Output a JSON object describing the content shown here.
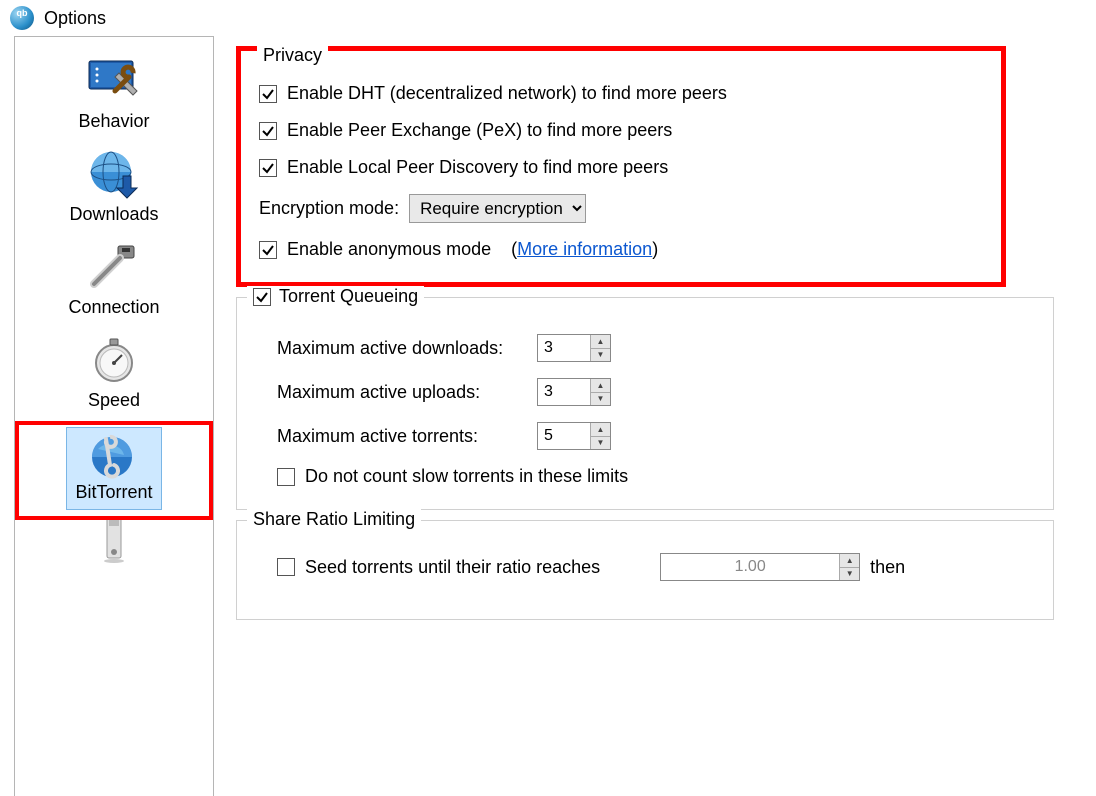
{
  "window": {
    "title": "Options"
  },
  "sidebar": {
    "items": [
      {
        "label": "Behavior"
      },
      {
        "label": "Downloads"
      },
      {
        "label": "Connection"
      },
      {
        "label": "Speed"
      },
      {
        "label": "BitTorrent"
      }
    ]
  },
  "privacy": {
    "title": "Privacy",
    "dht": "Enable DHT (decentralized network) to find more peers",
    "pex": "Enable Peer Exchange (PeX) to find more peers",
    "lpd": "Enable Local Peer Discovery to find more peers",
    "encryption_label": "Encryption mode:",
    "encryption_value": "Require encryption",
    "anonymous": "Enable anonymous mode",
    "more_info": "More information"
  },
  "queueing": {
    "title": "Torrent Queueing",
    "max_dl_label": "Maximum active downloads:",
    "max_dl_value": "3",
    "max_ul_label": "Maximum active uploads:",
    "max_ul_value": "3",
    "max_t_label": "Maximum active torrents:",
    "max_t_value": "5",
    "slow": "Do not count slow torrents in these limits"
  },
  "ratio": {
    "title": "Share Ratio Limiting",
    "seed_until": "Seed torrents until their ratio reaches",
    "ratio_value": "1.00",
    "then": "then"
  }
}
